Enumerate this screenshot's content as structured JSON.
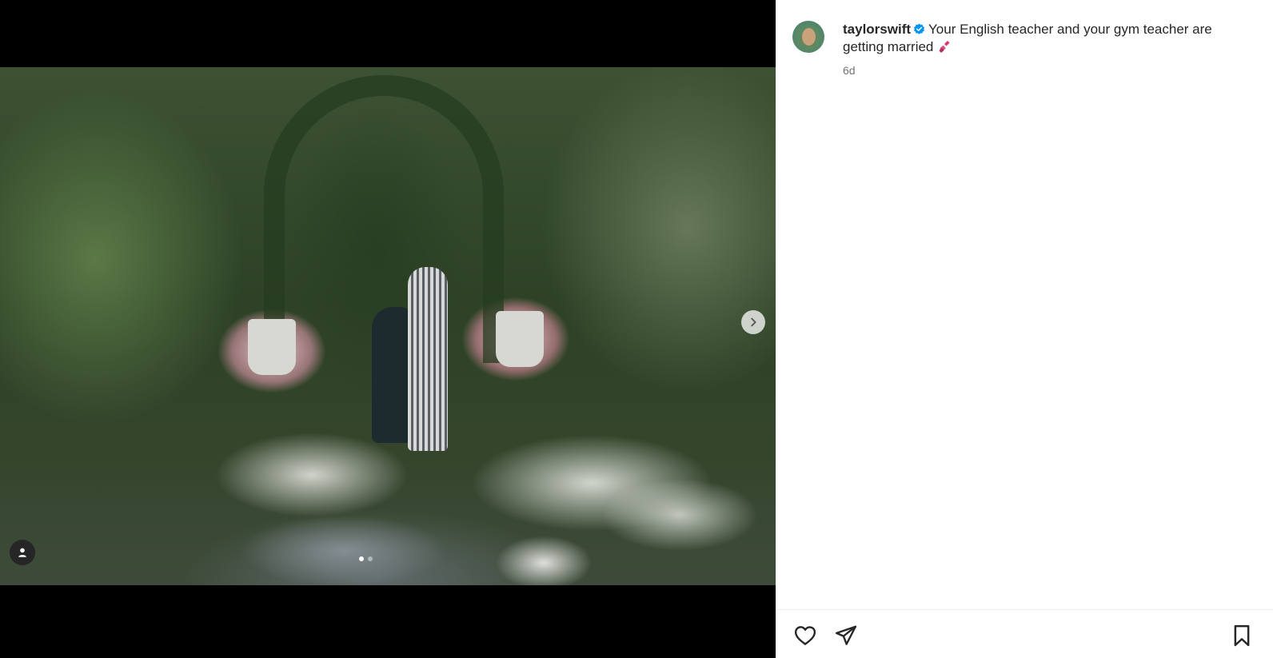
{
  "post": {
    "username": "taylorswift",
    "caption": "Your English teacher and your gym teacher are getting married",
    "timestamp": "6d",
    "carousel": {
      "current_slide": 1,
      "total_slides": 2
    }
  },
  "icons": {
    "verified": "verified-badge-icon",
    "caption_emoji": "lipstick-emoji-icon",
    "next": "chevron-right-icon",
    "tags": "user-tag-icon",
    "like": "heart-icon",
    "share": "paper-plane-icon",
    "save": "bookmark-icon"
  },
  "colors": {
    "verified_blue": "#0095f6",
    "text": "#262626",
    "muted": "#737373",
    "media_background": "#000000"
  }
}
